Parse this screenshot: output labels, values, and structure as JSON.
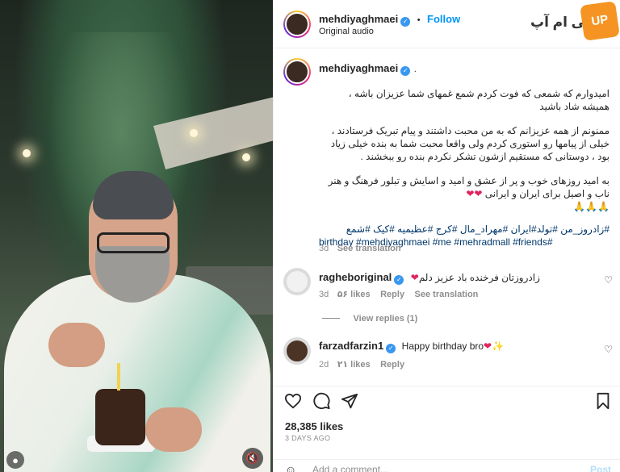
{
  "media": {
    "camera_icon": "camera-icon",
    "mute_icon": "speaker-muted-icon"
  },
  "header": {
    "username": "mehdiyaghmaei",
    "separator": "•",
    "follow_label": "Follow",
    "audio": "Original audio"
  },
  "watermark": {
    "text": "پی ام آپ",
    "badge": "UP PM"
  },
  "caption": {
    "username": "mehdiyaghmaei",
    "dot": ".",
    "line1": "امیدوارم که شمعی که فوت کردم شمع غمهای شما عزیزان باشه ،",
    "line2": "همیشه شاد باشید",
    "line3": "ممنونم از همه عزیزانم که به من محبت داشتند و پیام تبریک فرستادند ،",
    "line4": "خیلی از پیامها رو استوری کردم ولی واقعا محبت شما به بنده خیلی زیاد",
    "line5": "بود ، دوستانی که مستقیم ازشون تشکر نکردم بنده رو ببخشند .",
    "line6": "به امید روزهای خوب و پر از عشق و امید و اسایش و تبلور فرهنگ و هنر",
    "line7": "ناب و اصیل برای ایران و ایرانی",
    "hearts": "❤❤",
    "prayers": "🙏🙏🙏",
    "tags1": "#زادروز_من #تولد#ایران #مهراد_مال #کرج #عظیمیه #کیک #شمع",
    "tags2": "birthday #mehdiyaghmaei #me #mehradmall #friends#",
    "time": "3d",
    "see_translation": "See translation"
  },
  "comments": [
    {
      "username": "ragheboriginal",
      "text": "زادروزتان فرخنده باد عزیز دلم",
      "heart": "❤",
      "time": "3d",
      "likes": "۵۶ likes",
      "reply": "Reply",
      "see_translation": "See translation",
      "view_replies": "View replies (1)"
    },
    {
      "username": "farzadfarzin1",
      "text": "Happy birthday bro",
      "heart": "❤",
      "extra": "✨",
      "time": "2d",
      "likes": "۲۱ likes",
      "reply": "Reply"
    }
  ],
  "actions": {
    "likes": "28,385 likes",
    "date": "3 DAYS AGO",
    "comment_placeholder": "Add a comment...",
    "post_label": "Post"
  },
  "colors": {
    "accent": "#0095f6",
    "verified": "#3897f0",
    "heart": "#e0245e",
    "muted": "#8e8e8e"
  }
}
